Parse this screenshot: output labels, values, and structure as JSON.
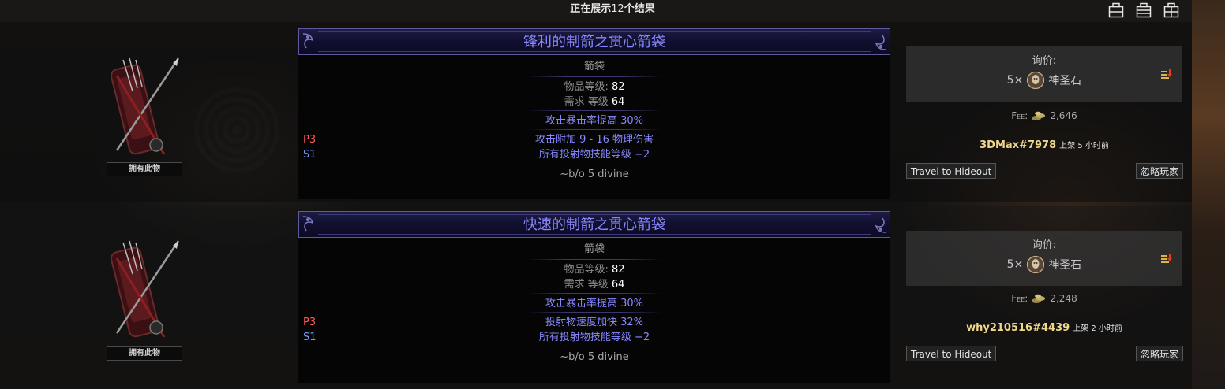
{
  "header": {
    "results_prefix": "正在展示",
    "results_count": "12",
    "results_suffix": "个结果"
  },
  "layout_icons": [
    "layout-single-icon",
    "layout-list-icon",
    "layout-grid-icon"
  ],
  "listings": [
    {
      "owned_label": "拥有此物",
      "item_name": "锋利的制箭之贯心箭袋",
      "base_type": "箭袋",
      "item_level_label": "物品等级:",
      "item_level": "82",
      "req_level_label": "需求 等级",
      "req_level": "64",
      "implicit": "攻击暴击率提高 30%",
      "mods": [
        {
          "tag": "P3",
          "text": "攻击附加 9 - 16 物理伤害"
        },
        {
          "tag": "S1",
          "text": "所有投射物技能等级 +2"
        }
      ],
      "note": "~b/o 5 divine",
      "ask_label": "询价:",
      "price_amount": "5×",
      "currency": "神圣石",
      "fee_label": "Fee:",
      "fee_amount": "2,646",
      "seller": "3DMax#7978",
      "listed": "上架 5 小时前",
      "travel_button": "Travel to Hideout",
      "ignore_button": "忽略玩家"
    },
    {
      "owned_label": "拥有此物",
      "item_name": "快速的制箭之贯心箭袋",
      "base_type": "箭袋",
      "item_level_label": "物品等级:",
      "item_level": "82",
      "req_level_label": "需求 等级",
      "req_level": "64",
      "implicit": "攻击暴击率提高 30%",
      "mods": [
        {
          "tag": "P3",
          "text": "投射物速度加快 32%"
        },
        {
          "tag": "S1",
          "text": "所有投射物技能等级 +2"
        }
      ],
      "note": "~b/o 5 divine",
      "ask_label": "询价:",
      "price_amount": "5×",
      "currency": "神圣石",
      "fee_label": "Fee:",
      "fee_amount": "2,248",
      "seller": "why210516#4439",
      "listed": "上架 2 小时前",
      "travel_button": "Travel to Hideout",
      "ignore_button": "忽略玩家"
    }
  ],
  "colors": {
    "magic_item": "#8888ff",
    "prefix_tag": "#ff5c5c",
    "suffix_tag": "#7f9aff",
    "seller": "#f0d78c"
  }
}
